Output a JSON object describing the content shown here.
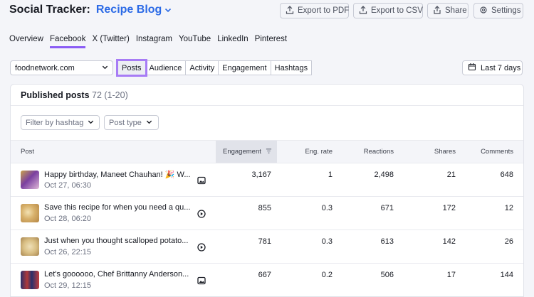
{
  "header": {
    "app_title": "Social Tracker:",
    "project_name": "Recipe Blog",
    "buttons": {
      "export_pdf": "Export to PDF",
      "export_csv": "Export to CSV",
      "share": "Share",
      "settings": "Settings"
    }
  },
  "tabs": [
    {
      "label": "Overview",
      "active": false
    },
    {
      "label": "Facebook",
      "active": true
    },
    {
      "label": "X (Twitter)",
      "active": false
    },
    {
      "label": "Instagram",
      "active": false
    },
    {
      "label": "YouTube",
      "active": false
    },
    {
      "label": "LinkedIn",
      "active": false
    },
    {
      "label": "Pinterest",
      "active": false
    }
  ],
  "toolbar": {
    "competitor_select": "foodnetwork.com",
    "segments": [
      {
        "label": "Posts",
        "active": true
      },
      {
        "label": "Audience",
        "active": false
      },
      {
        "label": "Activity",
        "active": false
      },
      {
        "label": "Engagement",
        "active": false
      },
      {
        "label": "Hashtags",
        "active": false
      }
    ],
    "date_range": "Last 7 days"
  },
  "published": {
    "title": "Published posts",
    "count": "72 (1-20)",
    "filters": {
      "hashtag_placeholder": "Filter by hashtag",
      "post_type": "Post type"
    },
    "columns": {
      "post": "Post",
      "engagement": "Engagement",
      "eng_rate": "Eng. rate",
      "reactions": "Reactions",
      "shares": "Shares",
      "comments": "Comments"
    },
    "rows": [
      {
        "title": "Happy birthday, Maneet Chauhan! 🎉 W...",
        "date": "Oct 27, 06:30",
        "type_icon": "image-icon",
        "engagement": "3,167",
        "eng_rate": "1",
        "reactions": "2,498",
        "shares": "21",
        "comments": "648"
      },
      {
        "title": "Save this recipe for when you need a qu...",
        "date": "Oct 28, 06:20",
        "type_icon": "video-icon",
        "engagement": "855",
        "eng_rate": "0.3",
        "reactions": "671",
        "shares": "172",
        "comments": "12"
      },
      {
        "title": "Just when you thought scalloped potato...",
        "date": "Oct 26, 22:15",
        "type_icon": "video-icon",
        "engagement": "781",
        "eng_rate": "0.3",
        "reactions": "613",
        "shares": "142",
        "comments": "26"
      },
      {
        "title": "Let's goooooo, Chef Brittanny Anderson...",
        "date": "Oct 29, 12:15",
        "type_icon": "image-icon",
        "engagement": "667",
        "eng_rate": "0.2",
        "reactions": "506",
        "shares": "17",
        "comments": "144"
      }
    ]
  },
  "colors": {
    "accent": "#2b6ae6",
    "active_tab": "#8a5cf5",
    "highlight": "#a77cf5"
  }
}
